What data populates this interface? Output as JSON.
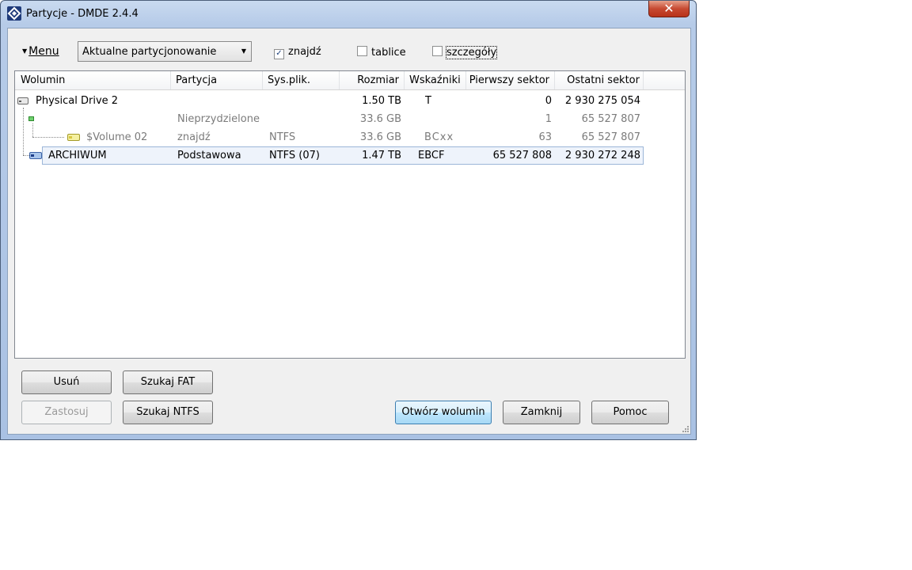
{
  "window": {
    "title": "Partycje - DMDE 2.4.4",
    "close_label": "✕"
  },
  "toolbar": {
    "menu_label": "Menu",
    "combo_value": "Aktualne partycjonowanie",
    "checkboxes": [
      {
        "label": "znajdź",
        "checked": true
      },
      {
        "label": "tablice",
        "checked": false
      },
      {
        "label": "szczegóły",
        "checked": false
      }
    ]
  },
  "table": {
    "columns": [
      "Wolumin",
      "Partycja",
      "Sys.plik.",
      "Rozmiar",
      "Wskaźniki",
      "Pierwszy sektor",
      "Ostatni sektor"
    ],
    "rows": [
      {
        "wolumin": "Physical Drive 2",
        "partycja": "",
        "sys": "",
        "rozmiar": "1.50 TB",
        "wskazniki": "T",
        "pierwszy": "0",
        "ostatni": "2 930 275 054"
      },
      {
        "wolumin": "",
        "partycja": "Nieprzydzielone",
        "sys": "",
        "rozmiar": "33.6 GB",
        "wskazniki": "",
        "pierwszy": "1",
        "ostatni": "65 527 807"
      },
      {
        "wolumin": "$Volume 02",
        "partycja": "znajdź",
        "sys": "NTFS",
        "rozmiar": "33.6 GB",
        "wskazniki": "BCxx",
        "pierwszy": "63",
        "ostatni": "65 527 807"
      },
      {
        "wolumin": "ARCHIWUM",
        "partycja": "Podstawowa",
        "sys": "NTFS (07)",
        "rozmiar": "1.47 TB",
        "wskazniki": "EBCF",
        "pierwszy": "65 527 808",
        "ostatni": "2 930 272 248"
      }
    ]
  },
  "buttons": {
    "usun": "Usuń",
    "szukaj_fat": "Szukaj FAT",
    "zastosuj": "Zastosuj",
    "szukaj_ntfs": "Szukaj NTFS",
    "otworz": "Otwórz wolumin",
    "zamknij": "Zamknij",
    "pomoc": "Pomoc"
  },
  "colors": {
    "accent": "#3c7fb1",
    "selection": "#eef3fb",
    "close": "#c74a32"
  }
}
